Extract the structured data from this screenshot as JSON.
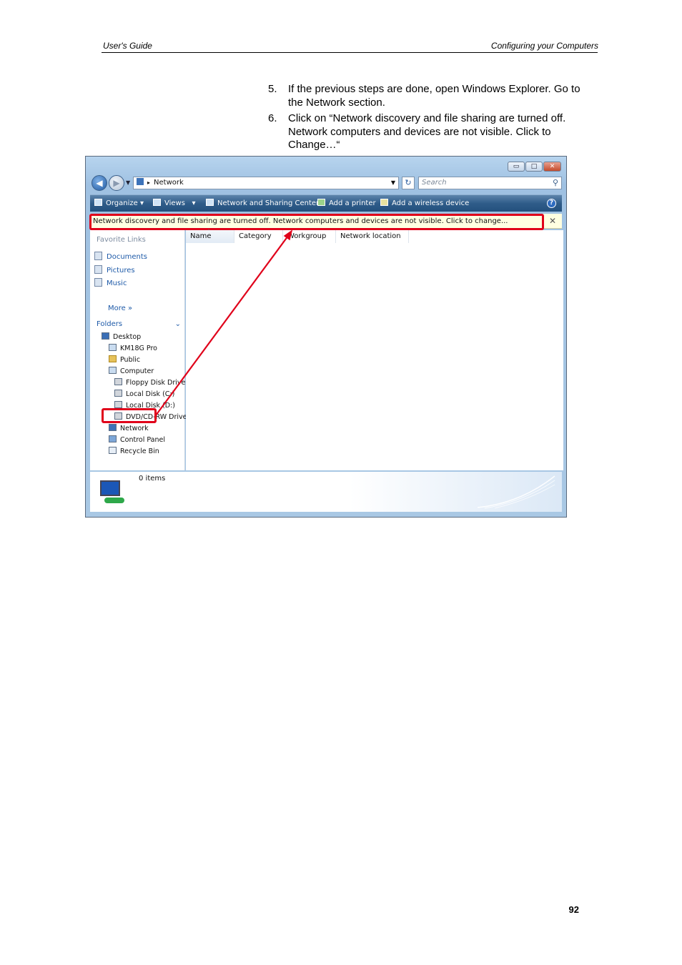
{
  "header": {
    "left": "User's Guide",
    "right": "Configuring your Computers"
  },
  "steps": [
    {
      "num": "5.",
      "text": "If the previous steps are done, open Windows Explorer. Go to the Network section."
    },
    {
      "num": "6.",
      "text": "Click on “Network discovery and file sharing are turned off. Network computers and devices are not visible. Click to Change…“"
    }
  ],
  "screenshot": {
    "address": "Network",
    "search_placeholder": "Search",
    "toolbar": {
      "organize": "Organize",
      "views": "Views",
      "network_sharing": "Network and Sharing Center",
      "add_printer": "Add a printer",
      "add_wireless": "Add a wireless device"
    },
    "infobar": "Network discovery and file sharing are turned off. Network computers and devices are not visible. Click to change...",
    "favorite_links_title": "Favorite Links",
    "favorite_links": [
      "Documents",
      "Pictures",
      "Music"
    ],
    "more": "More",
    "folders_title": "Folders",
    "tree": [
      "Desktop",
      "KM18G Pro",
      "Public",
      "Computer",
      "Floppy Disk Drive",
      "Local Disk (C:)",
      "Local Disk (D:)",
      "DVD/CD-RW Drive",
      "Network",
      "Control Panel",
      "Recycle Bin"
    ],
    "columns": [
      "Name",
      "Category",
      "Workgroup",
      "Network location"
    ],
    "status": "0 items"
  },
  "page_number": "92",
  "colors": {
    "highlight": "#e0001a",
    "link": "#1e5aa8",
    "toolbar": "#2f5c89"
  }
}
